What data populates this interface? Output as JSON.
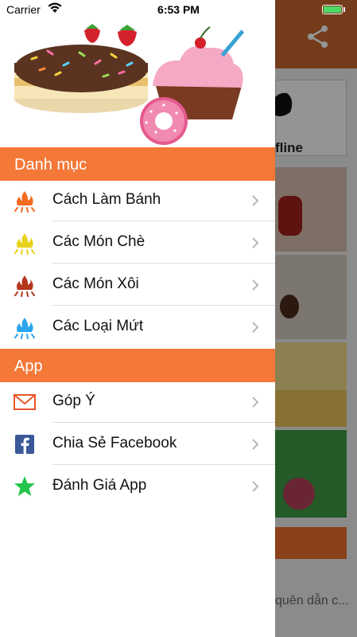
{
  "status_bar": {
    "carrier": "Carrier",
    "time": "6:53 PM"
  },
  "background": {
    "offline_label": "fline",
    "description": "quên dẫn c..."
  },
  "sections": [
    {
      "title": "Danh mục",
      "items": [
        {
          "label": "Cách Làm Bánh",
          "icon": "flame-icon",
          "color": "#f26b20"
        },
        {
          "label": "Các Món Chè",
          "icon": "flame-icon",
          "color": "#e8d21a"
        },
        {
          "label": "Các Món Xôi",
          "icon": "flame-icon",
          "color": "#b3361e"
        },
        {
          "label": "Các Loại Mứt",
          "icon": "flame-icon",
          "color": "#2aa5f0"
        }
      ]
    },
    {
      "title": "App",
      "items": [
        {
          "label": "Góp Ý",
          "icon": "mail-icon",
          "color": "#e8562a"
        },
        {
          "label": "Chia Sẻ Facebook",
          "icon": "facebook-icon",
          "color": "#3b5998"
        },
        {
          "label": "Đánh Giá App",
          "icon": "star-icon",
          "color": "#22c54a"
        }
      ]
    }
  ],
  "colors": {
    "section_header": "#f47838",
    "navbar": "#ef6c24"
  }
}
